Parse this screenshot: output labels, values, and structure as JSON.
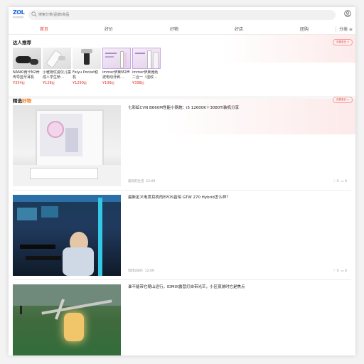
{
  "header": {
    "logo_text": "ZOL",
    "logo_sub": "中关村在线",
    "search_placeholder": "搜索分类/品牌/商品"
  },
  "nav": {
    "tabs": [
      "首页",
      "好价",
      "好物",
      "好店",
      "团购"
    ],
    "active": 0,
    "category_label": "分类 ≡"
  },
  "talent": {
    "title": "达人推荐",
    "more_label": "查看更多 >",
    "items": [
      {
        "name": "NANKI南卡N2骨传导蓝牙耳机",
        "price": "¥354",
        "unit": "起"
      },
      {
        "name": "小雅物优姿仪儿童成人学生矫…",
        "price": "¥128",
        "unit": "起"
      },
      {
        "name": "Feiyu Pocket稳机",
        "price": "¥1299",
        "unit": "起"
      },
      {
        "name": "immer伊莱M2声波电动牙刷…",
        "price": "¥199",
        "unit": "起"
      },
      {
        "name": "immer伊莱雅纸二合一（湿纹…",
        "price": "¥398",
        "unit": "起"
      }
    ]
  },
  "selected": {
    "title_a": "精选",
    "title_b": "好物",
    "more_label": "查看更多 >",
    "articles": [
      {
        "title": "七彩虹CVN B660M性能小钢炮：i5 12600K＋3080Ti装机分享",
        "author": "爱玩的生活",
        "time": "12:09",
        "likes": "0",
        "comments": "0"
      },
      {
        "title": "最新定义电竞耳机的EPOS音珀 GTW 270 Hybrid怎么样？",
        "author": "玩转2BB5",
        "time": "12:09",
        "likes": "0",
        "comments": "0"
      },
      {
        "title": "谁不能带它随山运行，IDMIX露营灯自带光芒，小区夜游时它是焦点",
        "author": "",
        "time": "",
        "likes": "",
        "comments": ""
      }
    ]
  },
  "colors": {
    "accent": "#e23a2e",
    "brand": "#1e63d8",
    "orange": "#f07b1a"
  }
}
